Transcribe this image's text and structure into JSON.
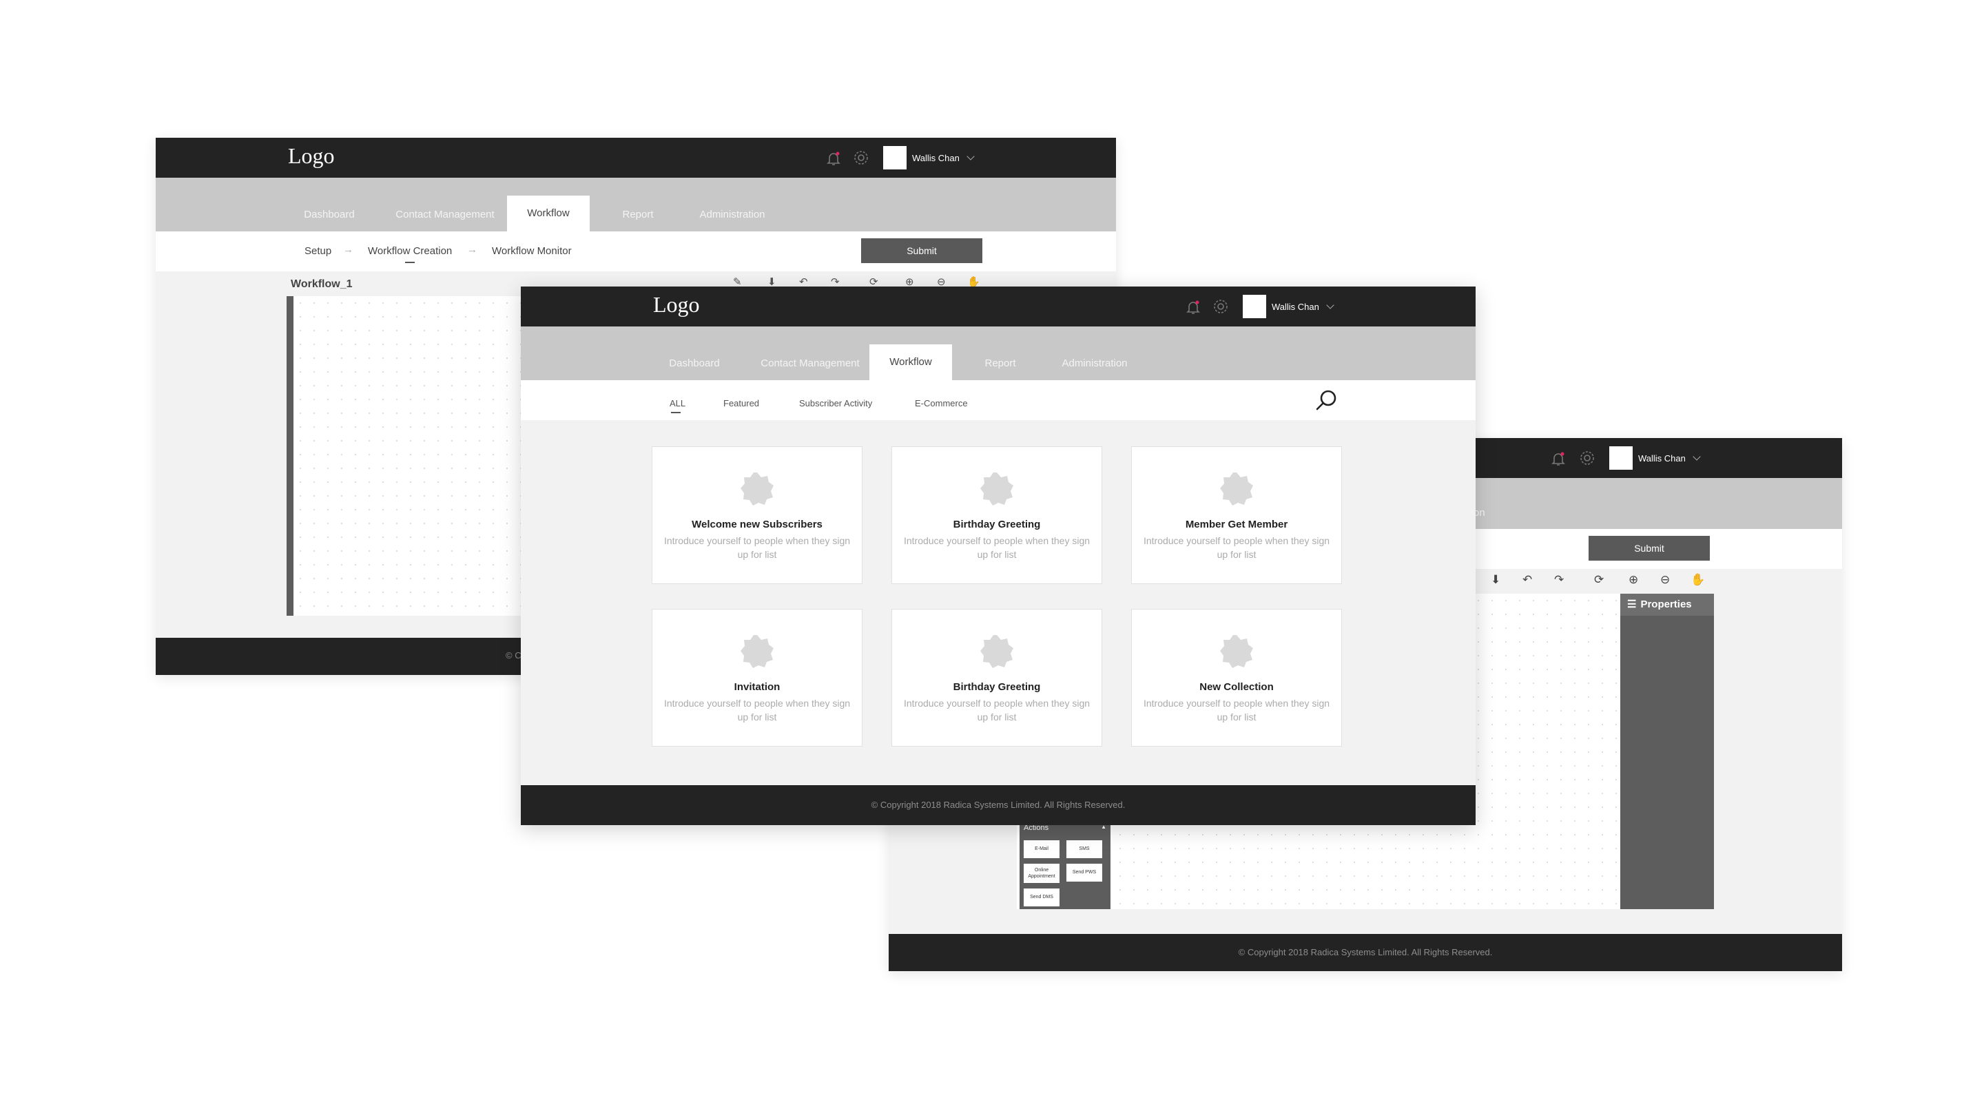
{
  "brand": {
    "logo": "Logo"
  },
  "user": {
    "name": "Wallis Chan"
  },
  "nav": {
    "tabs": [
      "Dashboard",
      "Contact Management",
      "Workflow",
      "Report",
      "Administration"
    ],
    "active": "Workflow"
  },
  "back_screen": {
    "steps": [
      "Setup",
      "Workflow Creation",
      "Workflow Monitor"
    ],
    "submit_label": "Submit",
    "workflow_name": "Workflow_1",
    "footer_visible": "© C"
  },
  "right_screen": {
    "partial_tab": "on",
    "submit_label": "Submit",
    "properties_label": "Properties",
    "actions": {
      "title": "Actions",
      "items": [
        "E-Mail",
        "SMS",
        "Online Appointment",
        "Send PWS",
        "Send DMS"
      ]
    },
    "footer": "© Copyright 2018 Radica Systems Limited. All Rights Reserved."
  },
  "front_screen": {
    "filters": [
      "ALL",
      "Featured",
      "Subscriber Activity",
      "E-Commerce"
    ],
    "active_filter": "ALL",
    "cards": [
      {
        "badge": "ICON",
        "title": "Welcome new Subscribers",
        "desc": "Introduce yourself to people when they sign up for list"
      },
      {
        "badge": "ICON",
        "title": "Birthday Greeting",
        "desc": "Introduce yourself to people when they sign up for list"
      },
      {
        "badge": "ICON",
        "title": "Member Get Member",
        "desc": "Introduce yourself to people when they sign up for list"
      },
      {
        "badge": "ICON",
        "title": "Invitation",
        "desc": "Introduce yourself to people when they sign up for list"
      },
      {
        "badge": "ICON",
        "title": "Birthday Greeting",
        "desc": "Introduce yourself to people when they sign up for list"
      },
      {
        "badge": "ICON",
        "title": "New Collection",
        "desc": "Introduce yourself to people when they sign up for list"
      }
    ],
    "footer": "© Copyright 2018 Radica Systems Limited. All Rights Reserved."
  },
  "icons": [
    "bell-icon",
    "gear-icon",
    "chevron-down-icon",
    "search-icon",
    "download-icon",
    "undo-icon",
    "redo-icon",
    "refresh-icon",
    "zoom-in-icon",
    "zoom-out-icon",
    "hand-icon",
    "pencil-icon",
    "tools-icon",
    "properties-icon"
  ],
  "colors": {
    "topbar": "#232323",
    "nav": "#c8c8c8",
    "canvas_bg": "#f2f2f2",
    "panel": "#5d5d5d",
    "notification_dot": "#e0245e"
  }
}
